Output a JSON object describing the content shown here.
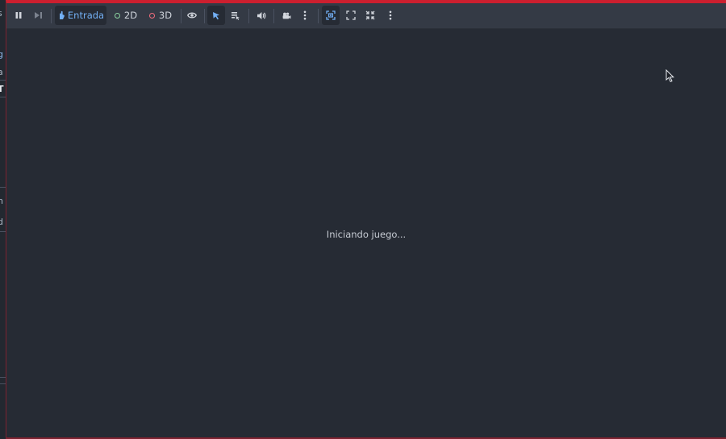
{
  "left_panel_fragments": [
    "s",
    "g",
    "a",
    "T",
    "n",
    "d"
  ],
  "toolbar": {
    "input_label": "Entrada",
    "view_2d_label": "2D",
    "view_3d_label": "3D"
  },
  "icons": {
    "pause": "pause-icon",
    "next_frame": "next-frame-icon",
    "input": "hand-pointer-icon",
    "view_2d": "circle-2d-icon",
    "view_3d": "circle-3d-icon",
    "visibility": "eye-icon",
    "select": "cursor-select-icon",
    "list_select": "list-select-icon",
    "audio": "speaker-icon",
    "camera": "camera-override-icon",
    "more1": "kebab-menu-icon",
    "keep_aspect": "keep-aspect-icon",
    "fullscreen": "fullscreen-icon",
    "fit": "fit-to-window-icon",
    "more2": "kebab-menu-icon"
  },
  "colors": {
    "accent_blue": "#73b0f5",
    "ring_2d": "#8bd3a0",
    "ring_3d": "#f26d7d",
    "running_border": "#cc1f2f"
  },
  "status_text": "Iniciando juego..."
}
